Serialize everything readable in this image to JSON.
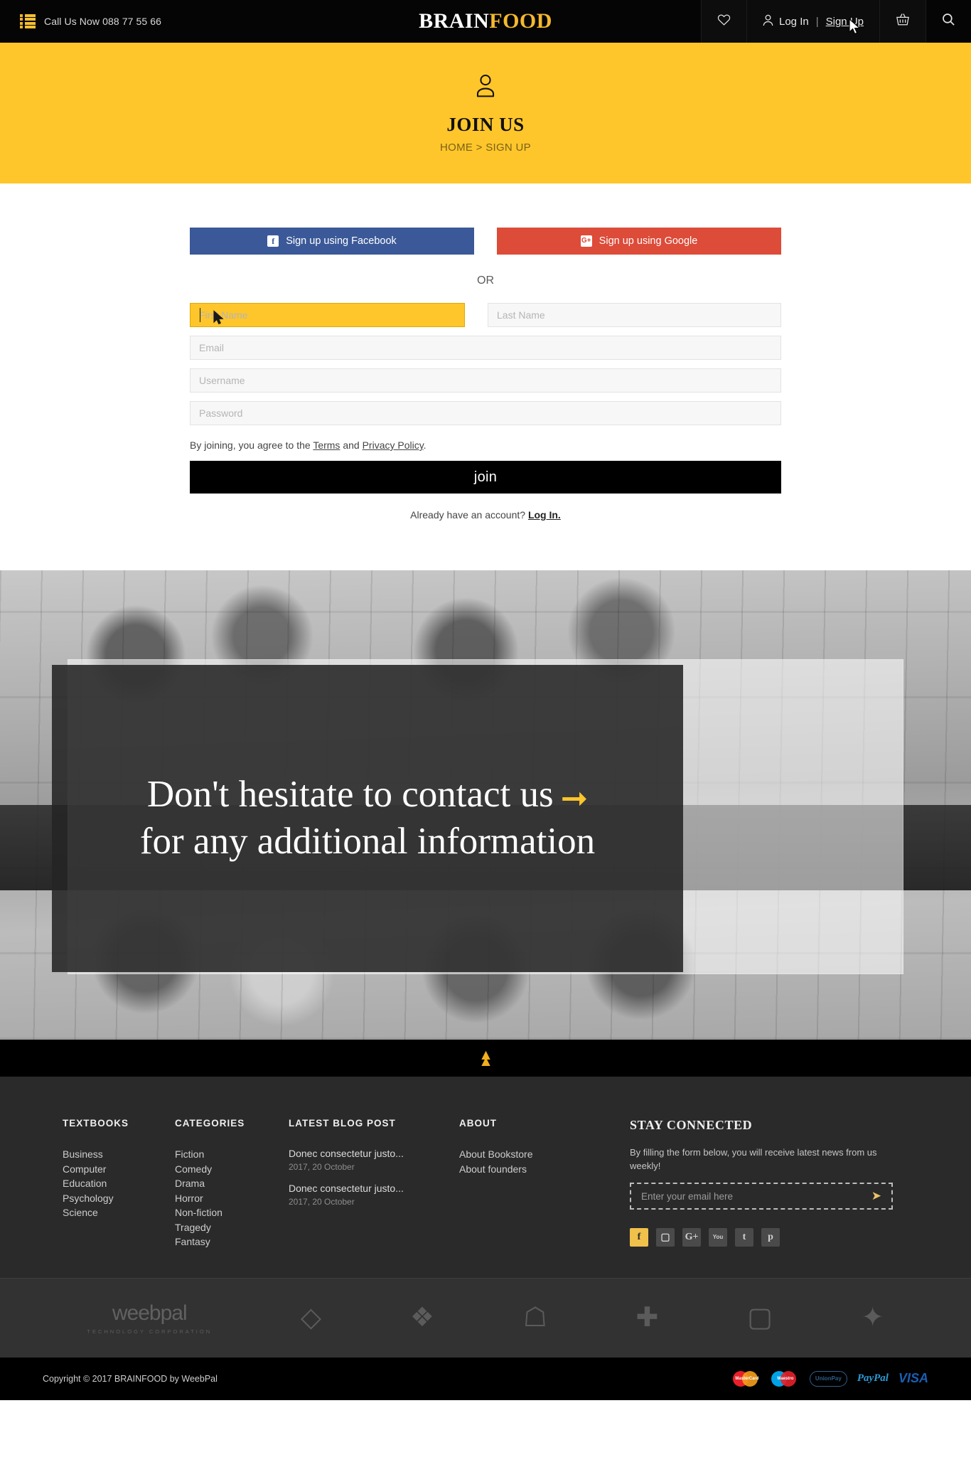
{
  "header": {
    "menu_icon": "list-menu-icon",
    "call_text": "Call Us Now  088 77 55 66",
    "brand_first": "BRAIN",
    "brand_second": "FOOD",
    "wishlist_icon": "heart-icon",
    "user_icon": "user-icon",
    "login_label": "Log In",
    "separator": "|",
    "signup_label": "Sign Up",
    "cart_icon": "basket-icon",
    "search_icon": "search-icon"
  },
  "banner": {
    "icon": "user-account-icon",
    "title": "JOIN US",
    "breadcrumb": "HOME > SIGN UP"
  },
  "signup": {
    "facebook_button": "Sign up using Facebook",
    "facebook_icon": "facebook-icon",
    "google_button": "Sign up using Google",
    "google_icon": "google-plus-icon",
    "or_label": "OR",
    "first_name_placeholder": "First Name",
    "first_name_value": "",
    "last_name_placeholder": "Last Name",
    "last_name_value": "",
    "email_placeholder": "Email",
    "email_value": "",
    "username_placeholder": "Username",
    "username_value": "",
    "password_placeholder": "Password",
    "password_value": "",
    "terms_prefix": "By joining, you agree to the ",
    "terms_link": "Terms",
    "terms_middle": " and ",
    "privacy_link": "Privacy Policy",
    "terms_suffix": ".",
    "join_button": "join",
    "already_text": "Already have an account? ",
    "login_link": "Log In."
  },
  "contact_hero": {
    "line1": "Don't hesitate to contact us",
    "arrow_icon": "right-arrow-icon",
    "line2": "for any additional information"
  },
  "scroll_top": {
    "icon": "double-chevron-up-icon"
  },
  "footer": {
    "textbooks": {
      "heading": "TEXTBOOKS",
      "items": [
        "Business",
        "Computer",
        "Education",
        "Psychology",
        "Science"
      ]
    },
    "categories": {
      "heading": "CATEGORIES",
      "items": [
        "Fiction",
        "Comedy",
        "Drama",
        "Horror",
        " Non-fiction",
        "Tragedy",
        "Fantasy"
      ]
    },
    "blog": {
      "heading": "LATEST BLOG POST",
      "posts": [
        {
          "title": "Donec consectetur justo...",
          "date": "2017, 20 October"
        },
        {
          "title": "Donec consectetur justo...",
          "date": "2017, 20 October"
        }
      ]
    },
    "about": {
      "heading": "ABOUT",
      "items": [
        "About Bookstore",
        "About founders"
      ]
    },
    "stay_connected": {
      "heading": "STAY CONNECTED",
      "description": "By filling the form below, you will receive latest news from us weekly!",
      "email_placeholder": "Enter your email here",
      "email_value": "",
      "send_icon": "paper-plane-icon",
      "socials": [
        {
          "name": "facebook-icon",
          "glyph": "f"
        },
        {
          "name": "instagram-icon",
          "glyph": "▢"
        },
        {
          "name": "google-plus-icon",
          "glyph": "G+"
        },
        {
          "name": "youtube-icon",
          "glyph": "You"
        },
        {
          "name": "tumblr-icon",
          "glyph": "t"
        },
        {
          "name": "pinterest-icon",
          "glyph": "р"
        }
      ]
    }
  },
  "partners": {
    "weebpal_name": "weebpal",
    "weebpal_sub": "TECHNOLOGY CORPORATION",
    "marks": [
      "partner-mark-m",
      "partner-mark-diamond",
      "partner-mark-house",
      "partner-mark-cross",
      "partner-mark-square",
      "partner-mark-star"
    ]
  },
  "copyright": {
    "text": "Copyright © 2017 BRAINFOOD by WeebPal",
    "payments": [
      "MasterCard",
      "Maestro",
      "UnionPay",
      "PayPal",
      "VISA"
    ]
  },
  "colors": {
    "accent_yellow": "#ffc62b",
    "brand_gold": "#f5b82e",
    "facebook_blue": "#3b5998",
    "google_red": "#dd4b39",
    "dark_footer": "#2a2a2a",
    "black": "#000000"
  }
}
